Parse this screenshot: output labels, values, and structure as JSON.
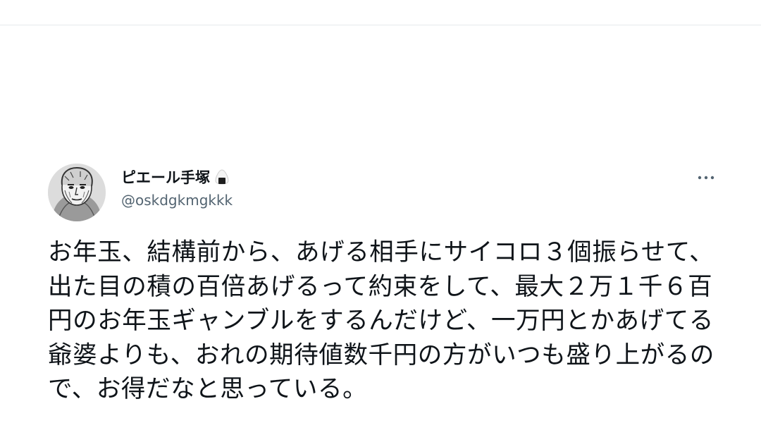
{
  "tweet": {
    "author": {
      "display_name": "ピエール手塚",
      "name_emoji": "onigiri-icon",
      "handle": "@oskdgkmgkkk",
      "avatar": "portrait-avatar"
    },
    "more_icon": "more-horizontal-icon",
    "text": "お年玉、結構前から、あげる相手にサイコロ３個振らせて、出た目の積の百倍あげるって約束をして、最大２万１千６百円のお年玉ギャンブルをするんだけど、一万円とかあげてる爺婆よりも、おれの期待値数千円の方がいつも盛り上がるので、お得だなと思っている。"
  },
  "colors": {
    "text": "#0f1419",
    "secondary": "#536471",
    "divider": "#e6e9eb"
  }
}
